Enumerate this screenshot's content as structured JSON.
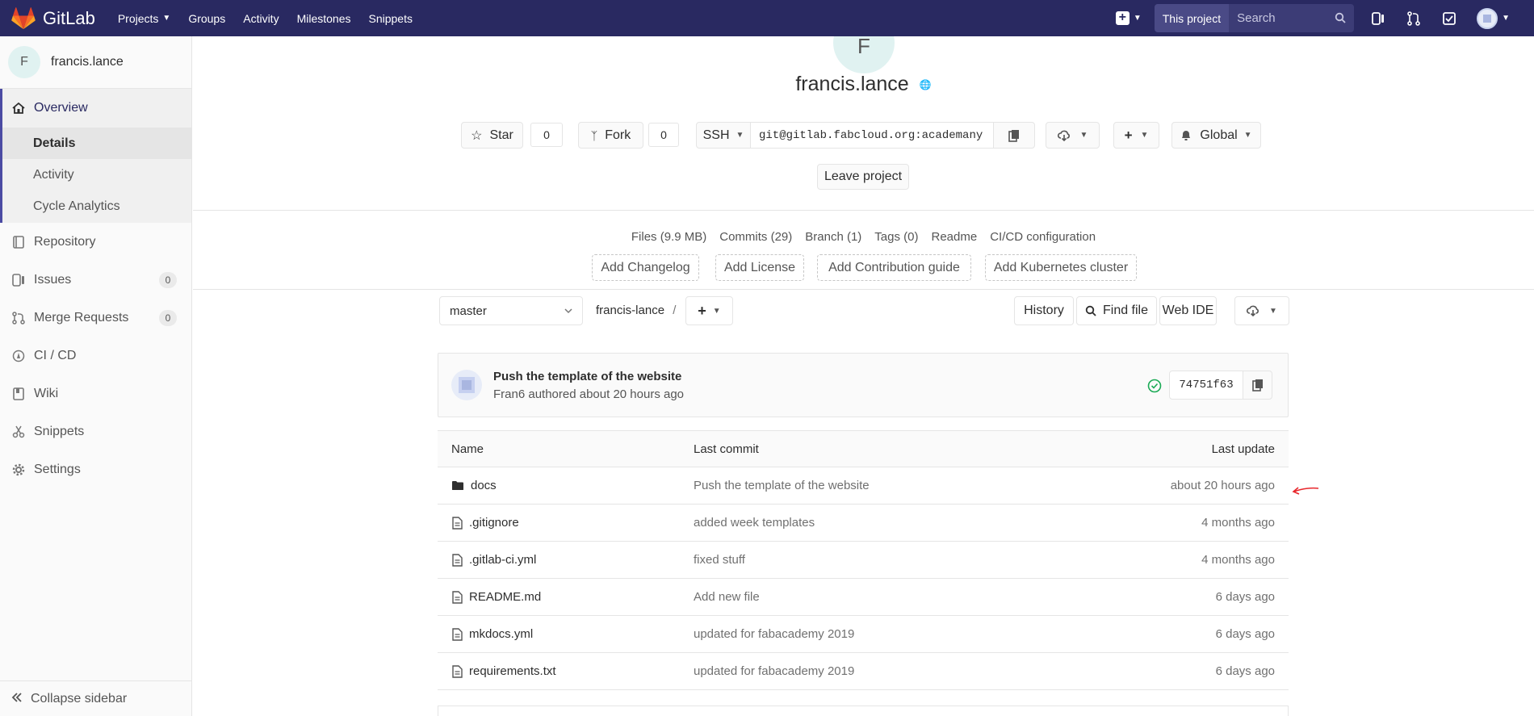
{
  "navbar": {
    "brand": "GitLab",
    "links": [
      {
        "label": "Projects",
        "dropdown": true
      },
      {
        "label": "Groups"
      },
      {
        "label": "Activity"
      },
      {
        "label": "Milestones"
      },
      {
        "label": "Snippets"
      }
    ],
    "search_scope": "This project",
    "search_placeholder": "Search"
  },
  "sidebar": {
    "context_avatar": "F",
    "context_name": "francis.lance",
    "overview": {
      "label": "Overview",
      "subitems": [
        "Details",
        "Activity",
        "Cycle Analytics"
      ],
      "active_subitem": "Details"
    },
    "items": [
      {
        "label": "Repository",
        "icon": "book-icon"
      },
      {
        "label": "Issues",
        "icon": "issues-icon",
        "count": "0"
      },
      {
        "label": "Merge Requests",
        "icon": "merge-request-icon",
        "count": "0"
      },
      {
        "label": "CI / CD",
        "icon": "rocket-icon"
      },
      {
        "label": "Wiki",
        "icon": "wiki-icon"
      },
      {
        "label": "Snippets",
        "icon": "scissors-icon"
      },
      {
        "label": "Settings",
        "icon": "gear-icon"
      }
    ],
    "collapse_label": "Collapse sidebar"
  },
  "project": {
    "avatar_letter": "F",
    "title": "francis.lance",
    "star_label": "Star",
    "star_count": "0",
    "fork_label": "Fork",
    "fork_count": "0",
    "clone_protocol": "SSH",
    "clone_url": "git@gitlab.fabcloud.org:academany",
    "notification_level": "Global",
    "leave_label": "Leave project"
  },
  "stats": [
    "Files (9.9 MB)",
    "Commits (29)",
    "Branch (1)",
    "Tags (0)",
    "Readme",
    "CI/CD configuration"
  ],
  "add_buttons": [
    "Add Changelog",
    "Add License",
    "Add Contribution guide",
    "Add Kubernetes cluster"
  ],
  "repo_nav": {
    "branch": "master",
    "path_root": "francis-lance",
    "path_sep": "/",
    "history_label": "History",
    "find_file_label": "Find file",
    "web_ide_label": "Web IDE"
  },
  "last_commit": {
    "title": "Push the template of the website",
    "author_line": "Fran6 authored about 20 hours ago",
    "sha": "74751f63",
    "pipeline_status": "passed"
  },
  "tree": {
    "headers": {
      "name": "Name",
      "last_commit": "Last commit",
      "last_update": "Last update"
    },
    "rows": [
      {
        "name": "docs",
        "type": "folder",
        "commit": "Push the template of the website",
        "updated": "about 20 hours ago"
      },
      {
        "name": ".gitignore",
        "type": "file",
        "commit": "added week templates",
        "updated": "4 months ago"
      },
      {
        "name": ".gitlab-ci.yml",
        "type": "file",
        "commit": "fixed stuff",
        "updated": "4 months ago"
      },
      {
        "name": "README.md",
        "type": "file",
        "commit": "Add new file",
        "updated": "6 days ago"
      },
      {
        "name": "mkdocs.yml",
        "type": "file",
        "commit": "updated for fabacademy 2019",
        "updated": "6 days ago"
      },
      {
        "name": "requirements.txt",
        "type": "file",
        "commit": "updated for fabacademy 2019",
        "updated": "6 days ago"
      }
    ]
  },
  "colors": {
    "navbar": "#292961",
    "sidebar_accent": "#4b4ba3",
    "annotation": "#e8262b",
    "pipeline_success": "#1aaa55"
  }
}
